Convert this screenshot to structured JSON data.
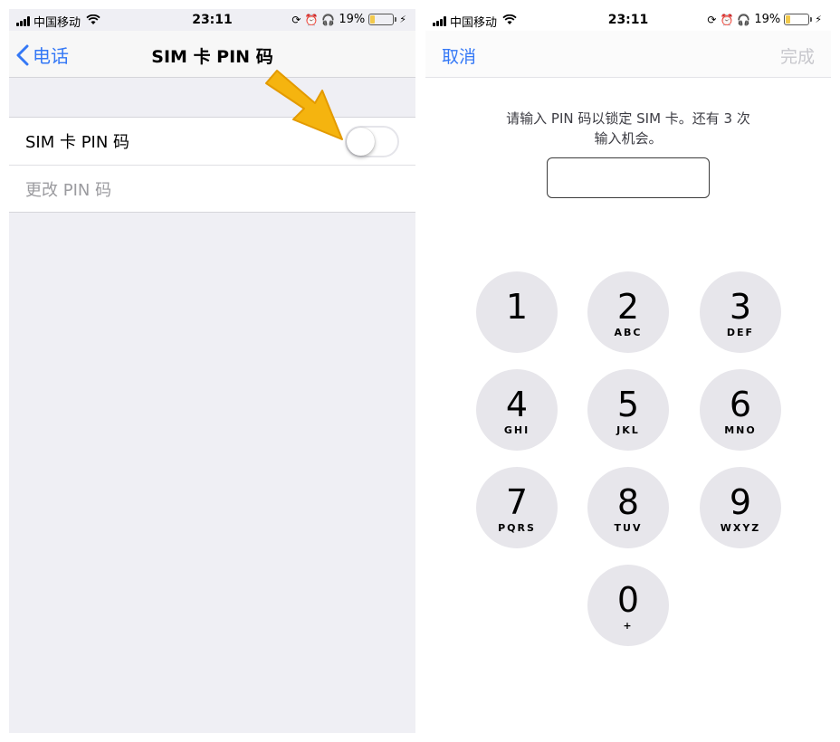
{
  "status_bar": {
    "carrier": "中国移动",
    "time": "23:11",
    "battery": "19%",
    "battery_level": 0.19,
    "icons": [
      "signal-icon",
      "wifi-icon",
      "orientation-lock-icon",
      "alarm-icon",
      "headphones-icon",
      "battery-icon",
      "charging-bolt-icon"
    ]
  },
  "left": {
    "nav": {
      "back_label": "电话",
      "title": "SIM 卡 PIN 码"
    },
    "rows": {
      "sim_pin_label": "SIM 卡 PIN 码",
      "sim_pin_enabled": false,
      "change_pin_label": "更改 PIN 码"
    },
    "annotation_color": "#f5b40f"
  },
  "right": {
    "nav": {
      "cancel_label": "取消",
      "done_label": "完成"
    },
    "prompt_line1": "请输入 PIN 码以锁定 SIM 卡。还有 3 次",
    "prompt_line2": "输入机会。",
    "pin_value": "",
    "keys": [
      {
        "digit": "1",
        "letters": ""
      },
      {
        "digit": "2",
        "letters": "ABC"
      },
      {
        "digit": "3",
        "letters": "DEF"
      },
      {
        "digit": "4",
        "letters": "GHI"
      },
      {
        "digit": "5",
        "letters": "JKL"
      },
      {
        "digit": "6",
        "letters": "MNO"
      },
      {
        "digit": "7",
        "letters": "PQRS"
      },
      {
        "digit": "8",
        "letters": "TUV"
      },
      {
        "digit": "9",
        "letters": "WXYZ"
      },
      {
        "digit": "0",
        "letters": "+"
      }
    ]
  },
  "colors": {
    "accent": "#3478f6",
    "disabled": "#c7c7cc",
    "key_bg": "#e7e6eb",
    "grouped_bg": "#efeff4"
  }
}
